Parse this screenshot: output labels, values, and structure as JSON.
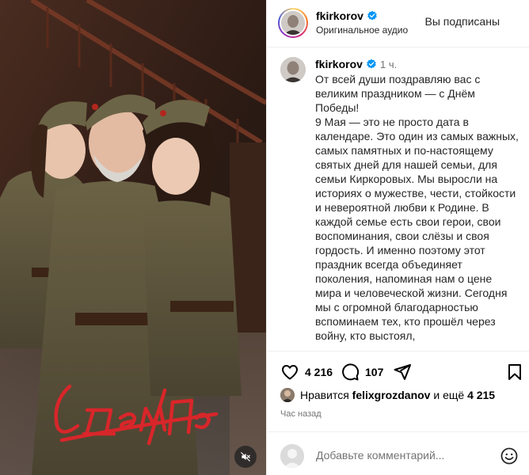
{
  "post": {
    "media_caption_art": "С Днём Победы"
  },
  "header": {
    "username": "fkirkorov",
    "audio": "Оригинальное аудио",
    "follow_state": "Вы подписаны"
  },
  "caption": {
    "username": "fkirkorov",
    "time": "1 ч.",
    "text": "От всей души поздравляю вас с великим праздником — с Днём Победы!\n9 Мая — это не просто дата в календаре. Это один из самых важных, самых памятных и по-настоящему святых дней для нашей семьи, для семьи Киркоровых. Мы выросли на историях о мужестве, чести, стойкости и невероятной любви к Родине. В каждой семье есть свои герои, свои воспоминания, свои слёзы и своя гордость. И именно поэтому этот праздник всегда объединяет поколения, напоминая нам о цене мира и человеческой жизни. Сегодня мы с огромной благодарностью вспоминаем тех, кто прошёл через войну, кто выстоял,"
  },
  "actions": {
    "likes_count": "4 216",
    "comments_count": "107",
    "liked_by_prefix": "Нравится",
    "liked_by_user": "felixgrozdanov",
    "liked_by_suffix_prefix": "и ещё",
    "liked_by_others": "4 215",
    "time_ago": "Час назад"
  },
  "comment": {
    "placeholder": "Добавьте комментарий..."
  },
  "icons": {
    "verified": "verified-badge-icon",
    "heart": "heart-icon",
    "comment": "comment-icon",
    "share": "share-icon",
    "bookmark": "bookmark-icon",
    "mute": "speaker-muted-icon",
    "emoji": "emoji-icon"
  },
  "colors": {
    "verified_blue": "#0095f6",
    "caption_art_red": "#d8262a",
    "secondary_text": "#737373"
  }
}
